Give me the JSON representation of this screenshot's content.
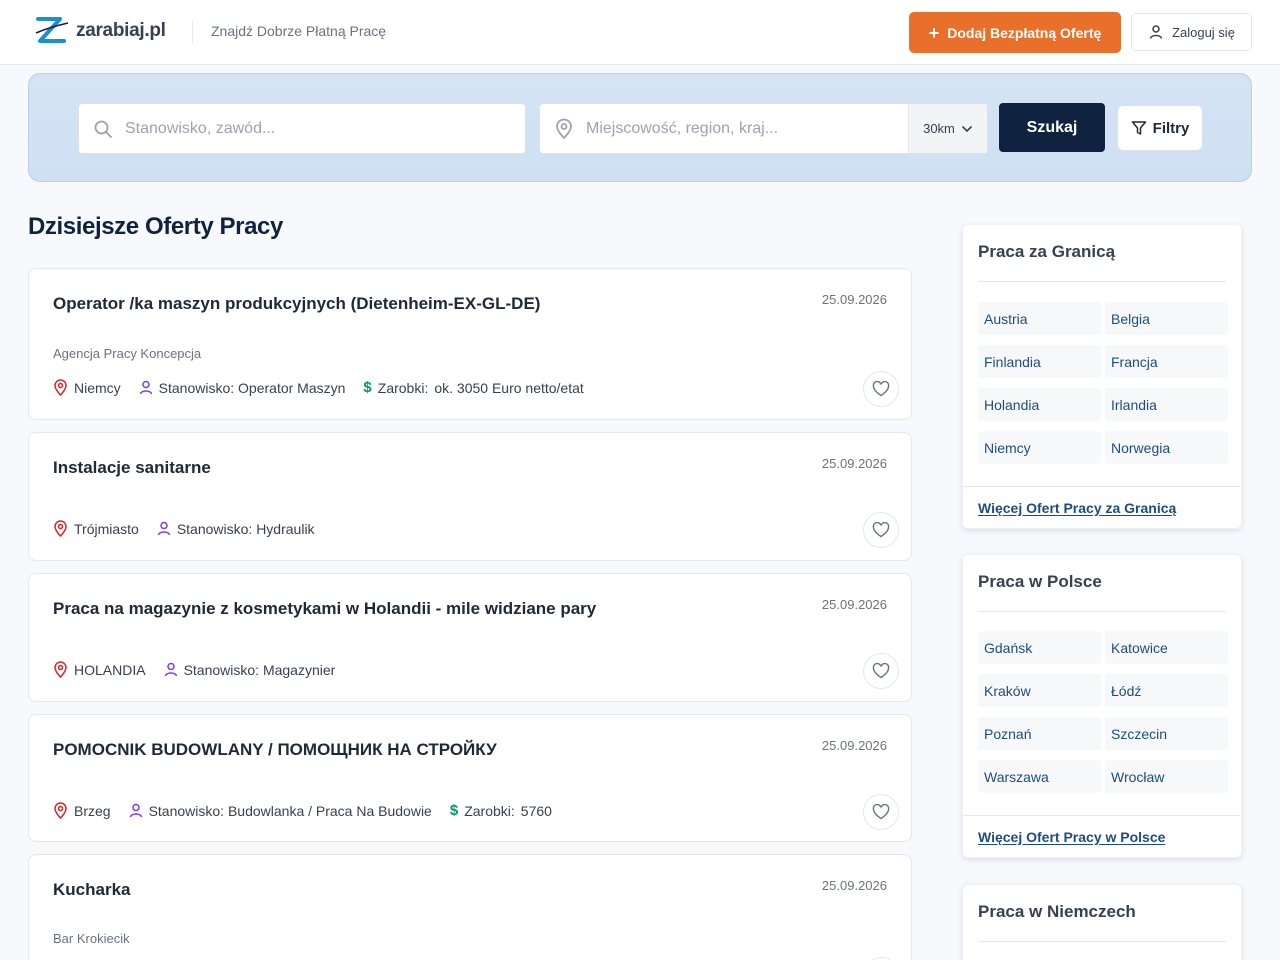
{
  "header": {
    "logo_text": "zarabiaj.pl",
    "tagline": "Znajdź Dobrze Płatną Pracę",
    "add_offer_label": "Dodaj Bezpłatną Ofertę",
    "login_label": "Zaloguj się"
  },
  "search": {
    "job_placeholder": "Stanowisko, zawód...",
    "location_placeholder": "Miejscowość, region, kraj...",
    "radius": "30km",
    "search_label": "Szukaj",
    "filters_label": "Filtry"
  },
  "main": {
    "title": "Dzisiejsze Oferty Pracy",
    "jobs": [
      {
        "title": "Operator /ka maszyn produkcyjnych (Dietenheim-EX-GL-DE)",
        "date": "25.09.2026",
        "company": "Agencja Pracy Koncepcja",
        "location": "Niemcy",
        "position": "Stanowisko: Operator Maszyn",
        "salary_label": "Zarobki:",
        "salary": "ok. 3050 Euro netto/etat"
      },
      {
        "title": "Instalacje sanitarne",
        "date": "25.09.2026",
        "location": "Trójmiasto",
        "position": "Stanowisko: Hydraulik"
      },
      {
        "title": "Praca na magazynie z kosmetykami w Holandii - mile widziane pary",
        "date": "25.09.2026",
        "location": "HOLANDIA",
        "position": "Stanowisko: Magazynier"
      },
      {
        "title": "POMOCNIK BUDOWLANY / ПОМОЩНИК НА СТРОЙКУ",
        "date": "25.09.2026",
        "location": "Brzeg",
        "position": "Stanowisko: Budowlanka / Praca Na Budowie",
        "salary_label": "Zarobki:",
        "salary": "5760"
      },
      {
        "title": "Kucharka",
        "date": "25.09.2026",
        "company": "Bar Krokiecik"
      }
    ]
  },
  "sidebar": {
    "abroad": {
      "title": "Praca za Granicą",
      "links": [
        "Austria",
        "Belgia",
        "Finlandia",
        "Francja",
        "Holandia",
        "Irlandia",
        "Niemcy",
        "Norwegia"
      ],
      "more": "Więcej Ofert Pracy za Granicą"
    },
    "poland": {
      "title": "Praca w Polsce",
      "links": [
        "Gdańsk",
        "Katowice",
        "Kraków",
        "Łódź",
        "Poznań",
        "Szczecin",
        "Warszawa",
        "Wrocław"
      ],
      "more": "Więcej Ofert Pracy w Polsce"
    },
    "germany": {
      "title": "Praca w Niemczech"
    }
  },
  "colors": {
    "brand_orange": "#e8702a",
    "navy": "#0f2340",
    "link_blue": "#1d4d80",
    "location_red": "#dc2626",
    "person_purple": "#7c3aed",
    "salary_green": "#059669"
  },
  "icons": {
    "search": "search-icon",
    "location": "location-pin-icon",
    "person": "person-icon",
    "salary": "dollar-icon",
    "favorite": "heart-icon",
    "filter": "filter-icon",
    "user": "user-icon",
    "plus": "plus-icon",
    "chevron": "chevron-down-icon"
  }
}
